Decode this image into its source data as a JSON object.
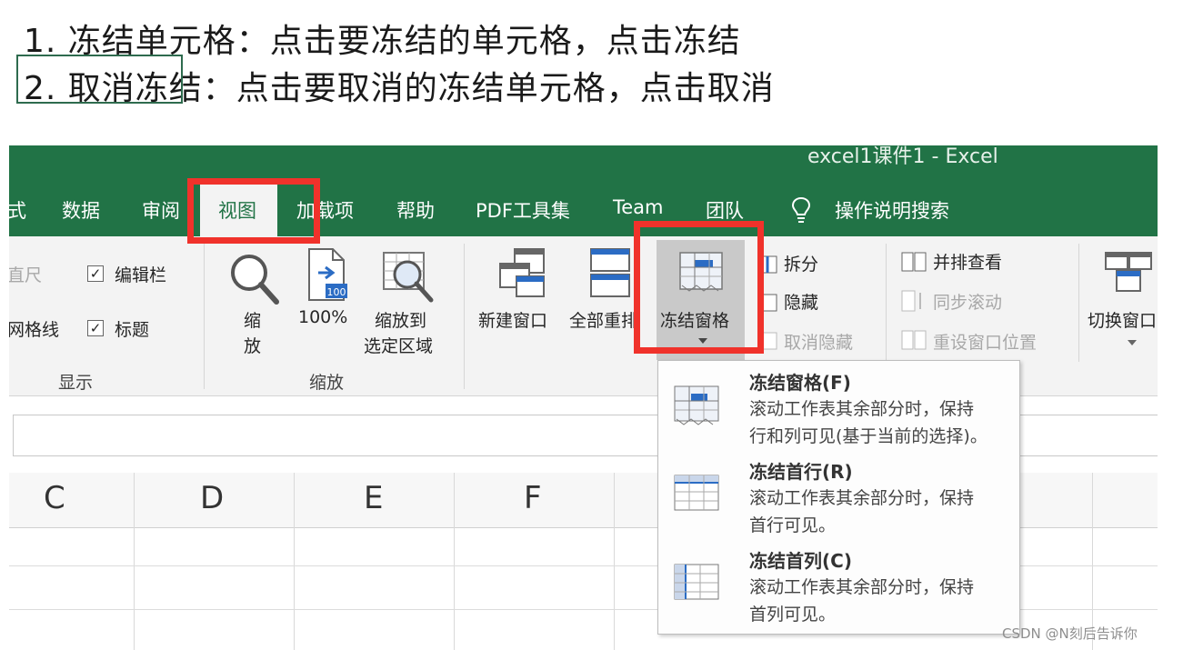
{
  "instructions": {
    "line1": "1. 冻结单元格：点击要冻结的单元格，点击冻结",
    "line2": "2. 取消冻结：点击要取消的冻结单元格，点击取消"
  },
  "window": {
    "title": "excel1课件1  -  Excel"
  },
  "tabs": [
    {
      "label": "式"
    },
    {
      "label": "数据"
    },
    {
      "label": "审阅"
    },
    {
      "label": "视图",
      "active": true
    },
    {
      "label": "加载项"
    },
    {
      "label": "帮助"
    },
    {
      "label": "PDF工具集"
    },
    {
      "label": "Team"
    },
    {
      "label": "团队"
    },
    {
      "label": "操作说明搜索"
    }
  ],
  "ribbon": {
    "show": {
      "ruler": "直尺",
      "formula_bar": "编辑栏",
      "gridlines": "网格线",
      "headings": "标题",
      "group": "显示"
    },
    "zoom": {
      "zoom_line1": "缩",
      "zoom_line2": "放",
      "zoom100": "100%",
      "zoom100_icon": "100",
      "zoom_sel_line1": "缩放到",
      "zoom_sel_line2": "选定区域",
      "group": "缩放"
    },
    "window": {
      "new_window": "新建窗口",
      "arrange_all": "全部重排",
      "freeze_panes": "冻结窗格",
      "split": "拆分",
      "hide": "隐藏",
      "unhide": "取消隐藏",
      "view_side": "并排查看",
      "sync_scroll": "同步滚动",
      "reset_pos": "重设窗口位置",
      "switch": "切换窗口"
    }
  },
  "columns": [
    "C",
    "D",
    "E",
    "F"
  ],
  "freeze_menu": {
    "items": [
      {
        "title": "冻结窗格(F)",
        "desc1": "滚动工作表其余部分时，保持",
        "desc2": "行和列可见(基于当前的选择)。"
      },
      {
        "title": "冻结首行(R)",
        "desc1": "滚动工作表其余部分时，保持",
        "desc2": "首行可见。"
      },
      {
        "title": "冻结首列(C)",
        "desc1": "滚动工作表其余部分时，保持",
        "desc2": "首列可见。"
      }
    ]
  },
  "watermark": "CSDN @N刻后告诉你",
  "colors": {
    "excel_green": "#217346",
    "highlight_red": "#f0322b",
    "icon_blue": "#2b6cc4"
  }
}
